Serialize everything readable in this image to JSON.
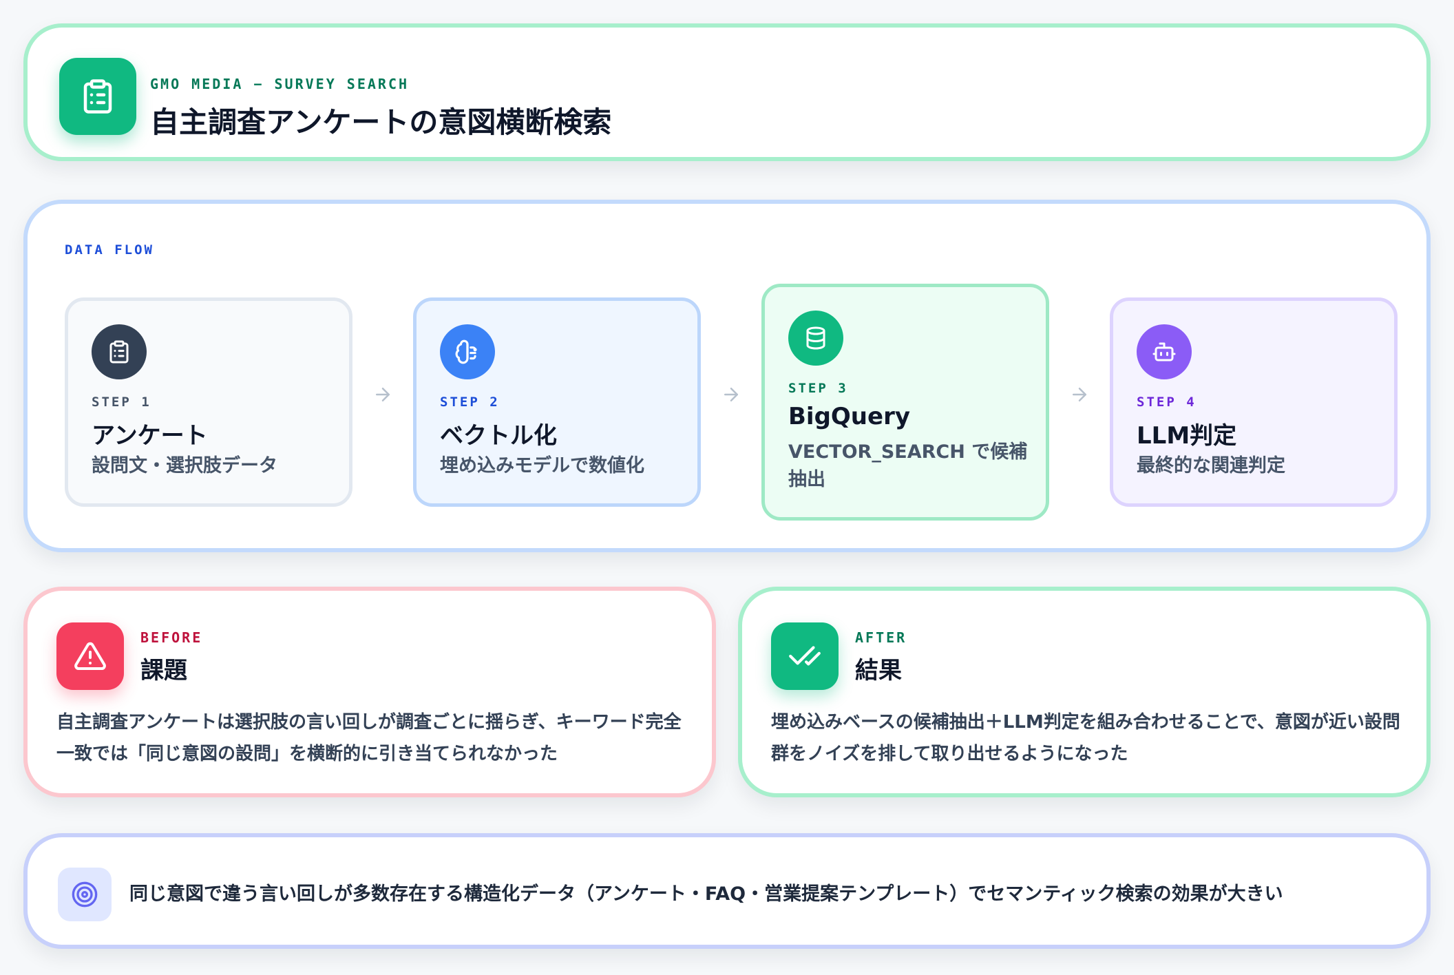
{
  "header": {
    "eyebrow": "GMO MEDIA − SURVEY SEARCH",
    "title": "自主調査アンケートの意図横断検索",
    "icon": "clipboard-icon"
  },
  "flow": {
    "label": "DATA FLOW",
    "steps": [
      {
        "num": "STEP 1",
        "title": "アンケート",
        "desc": "設問文・選択肢データ",
        "icon": "clipboard-icon",
        "color": "#334155"
      },
      {
        "num": "STEP 2",
        "title": "ベクトル化",
        "desc": "埋め込みモデルで数値化",
        "icon": "brain-icon",
        "color": "#3b82f6"
      },
      {
        "num": "STEP 3",
        "title": "BigQuery",
        "desc": "VECTOR_SEARCH で候補抽出",
        "icon": "database-icon",
        "color": "#10b981"
      },
      {
        "num": "STEP 4",
        "title": "LLM判定",
        "desc": "最終的な関連判定",
        "icon": "bot-icon",
        "color": "#8b5cf6"
      }
    ]
  },
  "before": {
    "tag": "BEFORE",
    "title": "課題",
    "body": "自主調査アンケートは選択肢の言い回しが調査ごとに揺らぎ、キーワード完全一致では「同じ意図の設問」を横断的に引き当てられなかった",
    "icon": "warning-icon",
    "color": "#f43f5e"
  },
  "after": {
    "tag": "AFTER",
    "title": "結果",
    "body": "埋め込みベースの候補抽出＋LLM判定を組み合わせることで、意図が近い設問群をノイズを排して取り出せるようになった",
    "icon": "double-check-icon",
    "color": "#10b981"
  },
  "insight": {
    "text": "同じ意図で違う言い回しが多数存在する構造化データ（アンケート・FAQ・営業提案テンプレート）でセマンティック検索の効果が大きい",
    "icon": "target-icon"
  }
}
